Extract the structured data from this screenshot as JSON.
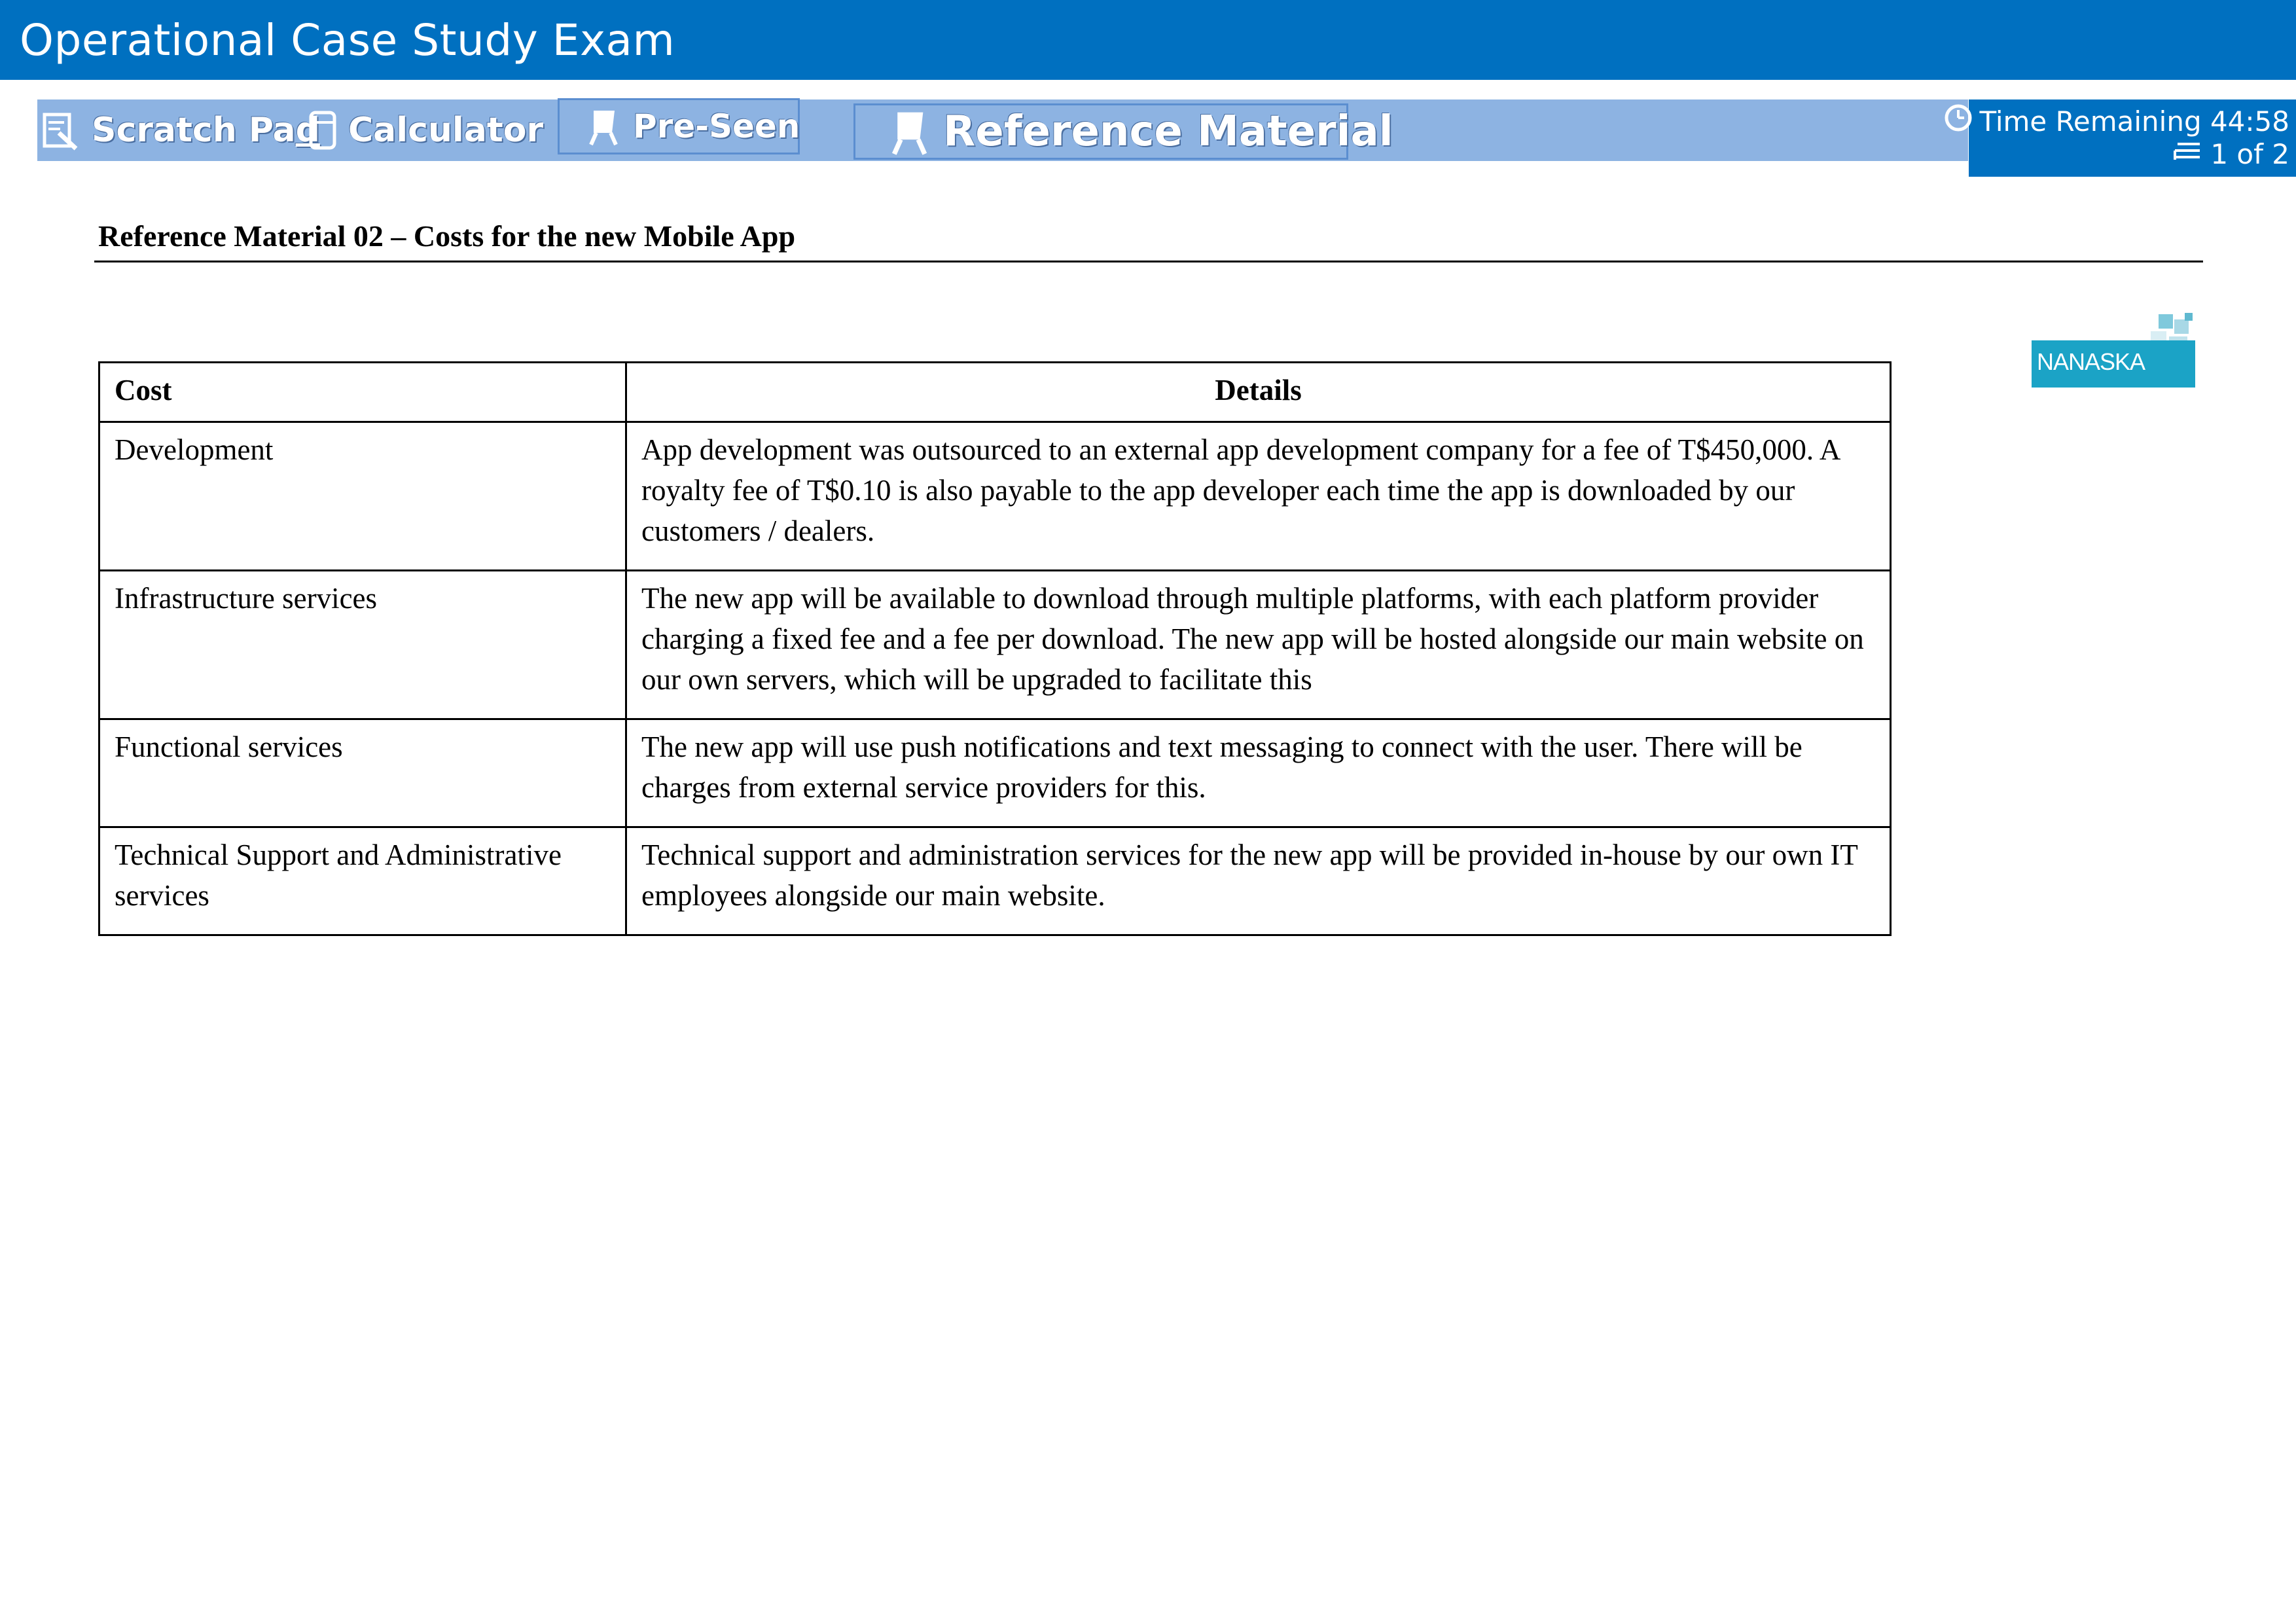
{
  "window": {
    "title": "Operational Case Study Exam"
  },
  "toolbar": {
    "scratch_pad": "Scratch Pa",
    "scratch_pad_underlined": "d",
    "calculator": "Calculator",
    "pre_seen": "Pre-Seen",
    "reference_material": "Reference Material"
  },
  "status": {
    "time_remaining": "Time Remaining 44:58",
    "page": "1 of 2"
  },
  "document": {
    "heading": "Reference Material 02 – Costs for the new Mobile App",
    "logo_text": "NANASKA"
  },
  "table": {
    "headers": [
      "Cost",
      "Details"
    ],
    "rows": [
      {
        "cost": "Development",
        "details": "App development was outsourced to an external app development company for a fee of T$450,000. A royalty fee of T$0.10 is also payable to the app developer each time the app is downloaded by our customers / dealers."
      },
      {
        "cost": "Infrastructure services",
        "details": "The new app will be available to download through multiple platforms, with each platform provider charging a fixed fee and a fee per download. The new app will be hosted alongside our main website on our own servers, which will be upgraded to facilitate this"
      },
      {
        "cost": "Functional services",
        "details": "The new app will use push notifications and text messaging to connect with the user. There will be charges from external service providers for this."
      },
      {
        "cost": "Technical Support and Administrative services",
        "details": "Technical support and administration services for the new app will be provided in-house by our own IT employees alongside our main website."
      }
    ]
  },
  "colors": {
    "title_bar": "#0070c0",
    "toolbar": "#8db3e2",
    "logo": "#1ba3c6"
  }
}
